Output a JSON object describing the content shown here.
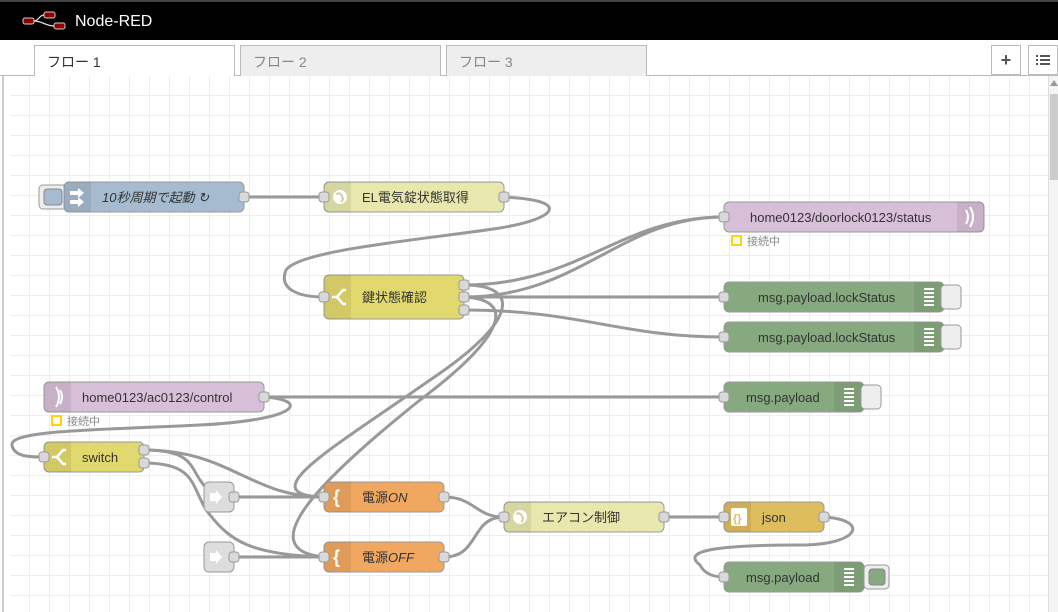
{
  "app": {
    "title": "Node-RED"
  },
  "tabs": [
    {
      "label": "フロー 1",
      "active": true
    },
    {
      "label": "フロー 2",
      "active": false
    },
    {
      "label": "フロー 3",
      "active": false
    }
  ],
  "toolbar": {
    "add_icon": "plus-icon",
    "list_icon": "list-icon"
  },
  "colors": {
    "inject": "#a6bbcf",
    "http": "#e7e7ae",
    "mqtt": "#d8bfd8",
    "switch": "#e2d96e",
    "debug": "#87a980",
    "template": "#f0a860",
    "link": "#dddddd",
    "json": "#debd5c",
    "wire": "#999999",
    "status": "#ffd400"
  },
  "nodes": {
    "inject": {
      "label": "10秒周期で起動 ↻"
    },
    "http_lock": {
      "label": "EL電気錠状態取得"
    },
    "switch_lock": {
      "label": "鍵状態確認"
    },
    "mqtt_out_lock": {
      "label": "home0123/doorlock0123/status",
      "status": "接続中"
    },
    "debug1": {
      "label": "msg.payload.lockStatus"
    },
    "debug2": {
      "label": "msg.payload.lockStatus"
    },
    "mqtt_in_ac": {
      "label": "home0123/ac0123/control",
      "status": "接続中"
    },
    "debug3": {
      "label": "msg.payload"
    },
    "switch_ac": {
      "label": "switch"
    },
    "template_on": {
      "label": "電源",
      "label_em": "ON"
    },
    "template_off": {
      "label": "電源",
      "label_em": "OFF"
    },
    "http_ac": {
      "label": "エアコン制御"
    },
    "json": {
      "label": "json"
    },
    "debug4": {
      "label": "msg.payload"
    }
  }
}
